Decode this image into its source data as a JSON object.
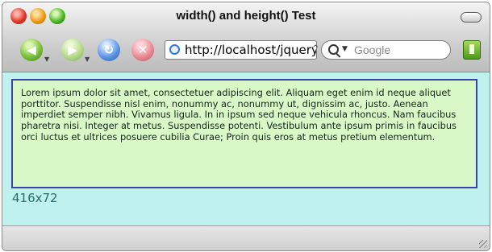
{
  "window": {
    "title": "width() and height() Test"
  },
  "toolbar": {
    "back_icon": "arrow-left-icon",
    "forward_icon": "arrow-right-icon",
    "reload_icon": "reload-icon",
    "stop_icon": "stop-icon",
    "address": "http://localhost/jquery/width-height.html",
    "search_placeholder": "Google",
    "bookmark_icon": "bookmark-icon"
  },
  "page": {
    "paragraph": "Lorem ipsum dolor sit amet, consectetuer adipiscing elit. Aliquam eget enim id neque aliquet porttitor. Suspendisse nisl enim, nonummy ac, nonummy ut, dignissim ac, justo. Aenean imperdiet semper nibh. Vivamus ligula. In in ipsum sed neque vehicula rhoncus. Nam faucibus pharetra nisi. Integer at metus. Suspendisse potenti. Vestibulum ante ipsum primis in faucibus orci luctus et ultrices posuere cubilia Curae; Proin quis eros at metus pretium elementum.",
    "dimensions_text": "416x72"
  },
  "colors": {
    "page_background": "#bff1ef",
    "box_background": "#d8f8c8",
    "box_border": "#3b43a6",
    "readout_text": "#2a6b6b"
  }
}
